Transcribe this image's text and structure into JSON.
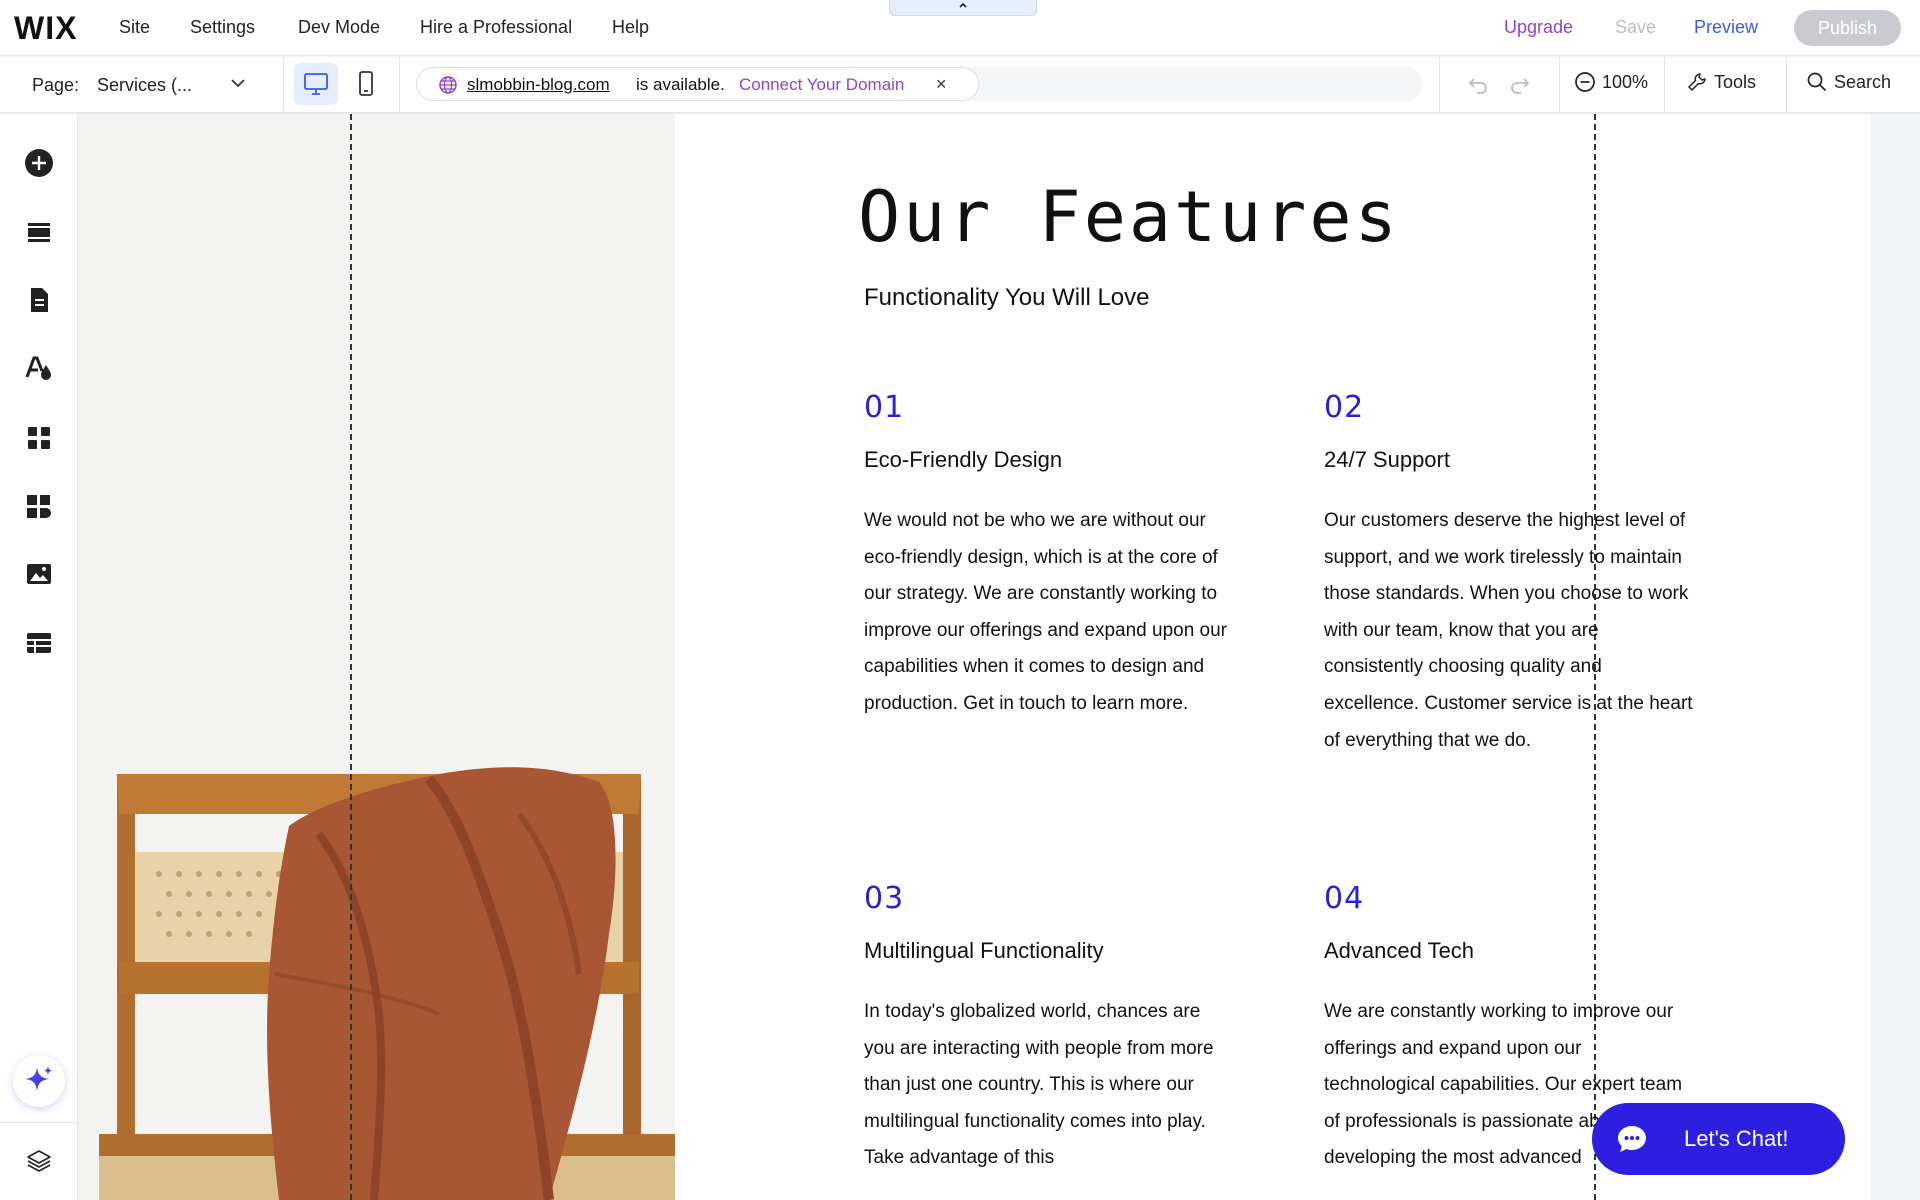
{
  "topbar": {
    "logo": "WIX",
    "nav": [
      "Site",
      "Settings",
      "Dev Mode",
      "Hire a Professional",
      "Help"
    ],
    "upgrade": "Upgrade",
    "save": "Save",
    "preview": "Preview",
    "publish": "Publish",
    "collapse_icon": "chevron-up-icon"
  },
  "subbar": {
    "page_label": "Page:",
    "page_value": "Services (...",
    "domain": {
      "name": "slmobbin-blog.com",
      "availability": "is available.",
      "connect": "Connect Your Domain",
      "close": "×"
    },
    "zoom": "100%",
    "tools": "Tools",
    "search": "Search"
  },
  "sidebar": {
    "icons": [
      "add-icon",
      "sections-icon",
      "pages-icon",
      "design-icon",
      "apps-icon",
      "business-apps-icon",
      "media-icon",
      "cms-icon"
    ],
    "ai_icon": "ai-sparkle-icon",
    "bottom_icon": "layers-icon"
  },
  "canvas": {
    "title": "Our Features",
    "subtitle": "Functionality You Will Love",
    "features": [
      {
        "num": "01",
        "title": "Eco-Friendly Design",
        "body": "We would not be who we are without our eco-friendly design, which is at the core of our strategy. We are constantly working to improve our offerings and expand upon our capabilities when it comes to design and production. Get in touch to learn more."
      },
      {
        "num": "02",
        "title": "24/7 Support",
        "body": "Our customers deserve the highest level of support, and we work tirelessly to maintain those standards. When you choose to work with our team, know that you are consistently choosing quality and excellence. Customer service is at the heart of everything that we do."
      },
      {
        "num": "03",
        "title": "Multilingual Functionality",
        "body": "In today's globalized world, chances are you are interacting with people from more than just one country. This is where our multilingual functionality comes into play. Take advantage of this"
      },
      {
        "num": "04",
        "title": "Advanced Tech",
        "body": "We are constantly working to improve our offerings and expand upon our technological capabilities. Our expert team of professionals is passionate about developing the most advanced"
      }
    ],
    "chat": "Let's Chat!"
  },
  "colors": {
    "accent_blue": "#2a1fd6",
    "upgrade_purple": "#8e44c9",
    "preview_blue": "#3b5be5",
    "chat_bg": "#2c1fe0",
    "sweater": "#a85634",
    "chair_wood": "#b06f2f"
  }
}
